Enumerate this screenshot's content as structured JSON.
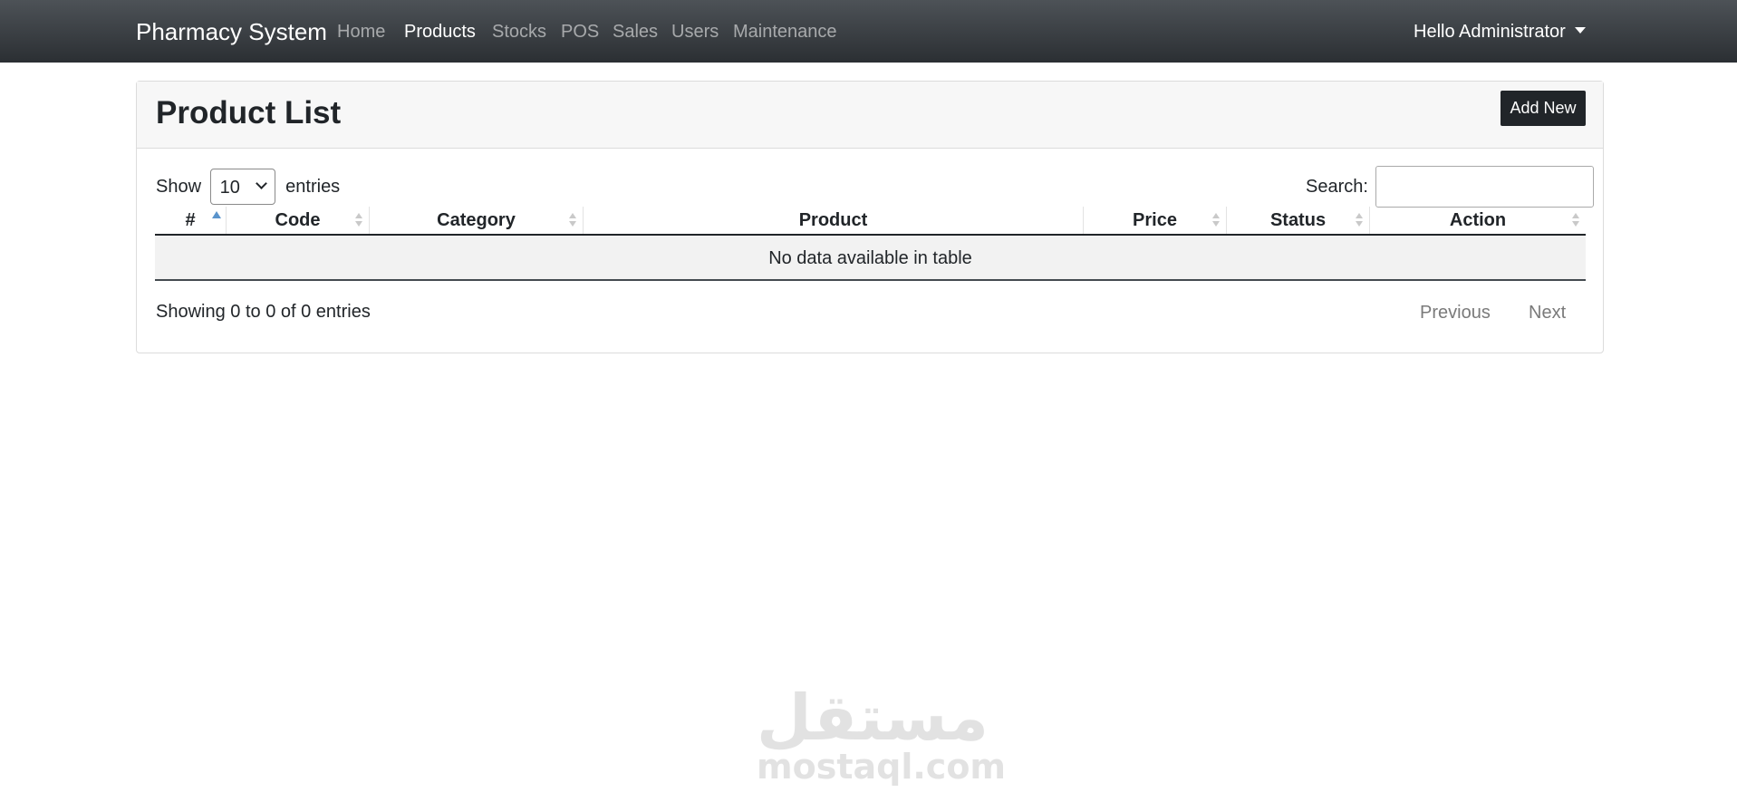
{
  "navbar": {
    "brand": "Pharmacy System",
    "links": [
      {
        "label": "Home",
        "active": false
      },
      {
        "label": "Products",
        "active": true
      },
      {
        "label": "Stocks",
        "active": false
      },
      {
        "label": "POS",
        "active": false
      },
      {
        "label": "Sales",
        "active": false
      },
      {
        "label": "Users",
        "active": false
      },
      {
        "label": "Maintenance",
        "active": false
      }
    ],
    "user_menu": "Hello Administrator"
  },
  "page": {
    "title": "Product List",
    "add_button": "Add New"
  },
  "table_controls": {
    "show_label": "Show",
    "entries_value": "10",
    "entries_label": "entries",
    "search_label": "Search:",
    "search_value": ""
  },
  "table": {
    "columns": [
      {
        "label": "#",
        "sort": "asc"
      },
      {
        "label": "Code",
        "sort": "none"
      },
      {
        "label": "Category",
        "sort": "none"
      },
      {
        "label": "Product",
        "sort": "disabled"
      },
      {
        "label": "Price",
        "sort": "none"
      },
      {
        "label": "Status",
        "sort": "none"
      },
      {
        "label": "Action",
        "sort": "none"
      }
    ],
    "empty_message": "No data available in table"
  },
  "footer": {
    "info": "Showing 0 to 0 of 0 entries",
    "previous": "Previous",
    "next": "Next"
  },
  "watermark": {
    "arabic": "مستقل",
    "latin": "mostaql.com"
  },
  "colors": {
    "navbar_top": "#4d5257",
    "navbar_bottom": "#2b2f33",
    "button_dark": "#212529",
    "sort_active": "#5a94cc",
    "empty_row_bg": "#f2f2f2"
  }
}
